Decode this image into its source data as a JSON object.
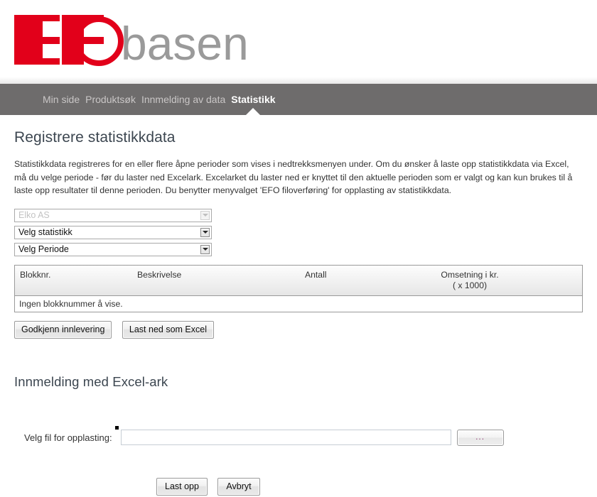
{
  "brand": {
    "logo_mark": "EFO",
    "logo_text": "basen",
    "logo_red": "#e2001a",
    "logo_gray": "#9a9a9a"
  },
  "nav": {
    "bar_color": "#6e6c6c",
    "items": [
      {
        "label": "Min side",
        "active": false
      },
      {
        "label": "Produktsøk",
        "active": false
      },
      {
        "label": "Innmelding av data",
        "active": false
      },
      {
        "label": "Statistikk",
        "active": true
      }
    ]
  },
  "page": {
    "title": "Registrere statistikkdata",
    "intro": "Statistikkdata registreres for en eller flere åpne perioder som vises i nedtrekksmenyen under. Om du ønsker å laste opp statistikkdata via Excel, må du velge periode - før du laster ned Excelark. Excelarket du laster ned er knyttet til den aktuelle perioden som er valgt og kan kun brukes til å laste opp resultater til denne perioden. Du benytter menyvalget 'EFO filoverføring' for opplasting av statistikkdata.",
    "title_color": "#3c4650"
  },
  "selects": [
    {
      "value": "Elko AS",
      "disabled": true,
      "name": "company-select"
    },
    {
      "value": "Velg statistikk",
      "disabled": false,
      "name": "statistics-select"
    },
    {
      "value": "Velg Periode",
      "disabled": false,
      "name": "period-select"
    }
  ],
  "table": {
    "columns": [
      "Blokknr.",
      "Beskrivelse",
      "Antall",
      "Omsetning i kr."
    ],
    "omsetning_sub": "( x 1000)",
    "empty_message": "Ingen blokknummer å vise.",
    "rows": []
  },
  "actions": {
    "approve": "Godkjenn innlevering",
    "download_excel": "Last ned som Excel"
  },
  "excel_section": {
    "title": "Innmelding med Excel-ark",
    "file_label": "Velg fil for opplasting:",
    "file_value": "",
    "file_placeholder": "",
    "browse_label": "...",
    "upload": "Last opp",
    "cancel": "Avbryt"
  }
}
